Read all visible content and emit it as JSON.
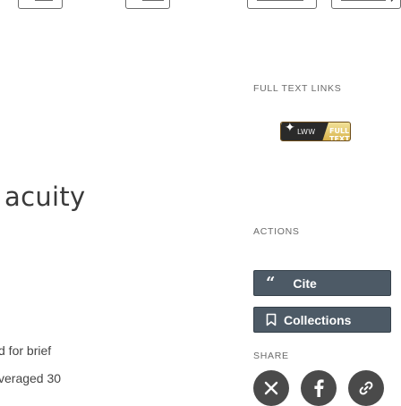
{
  "journal": {
    "name": "acuity"
  },
  "snippet": {
    "line1": "d for brief",
    "line2": "veraged 30"
  },
  "sidebar": {
    "full_text_label": "FULL TEXT LINKS",
    "actions_label": "ACTIONS",
    "cite_label": "Cite",
    "collections_label": "Collections",
    "share_label": "SHARE"
  },
  "badge": {
    "brand": "LWW",
    "cta": "FULL TEXT"
  },
  "colors": {
    "button_bg": "#4d5a66",
    "share_bg": "#4a4a4a",
    "badge_gold": "#d7b24a"
  },
  "icons": {
    "cite": "quote-icon",
    "collections": "bookmark-icon",
    "share": [
      "x-twitter-icon",
      "facebook-icon",
      "permalink-icon"
    ]
  }
}
